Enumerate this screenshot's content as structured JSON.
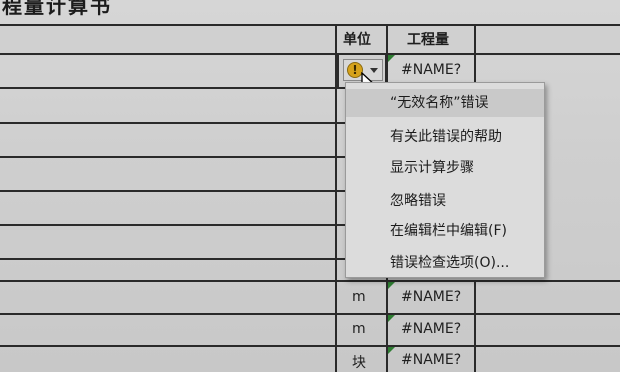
{
  "sheet": {
    "title": "程量计算书",
    "headers": {
      "unit": "单位",
      "quantity": "工程量"
    },
    "rows": [
      {
        "unit": "",
        "value": "#NAME?"
      },
      {
        "unit": "m",
        "value": "#NAME?"
      },
      {
        "unit": "m",
        "value": "#NAME?"
      },
      {
        "unit": "块",
        "value": "#NAME?"
      }
    ]
  },
  "error_button": {
    "icon": "warning-icon",
    "glyph": "!"
  },
  "context_menu": {
    "items": [
      {
        "label": "“无效名称”错误"
      },
      {
        "label": "有关此错误的帮助"
      },
      {
        "label": "显示计算步骤"
      },
      {
        "label": "忽略错误"
      },
      {
        "label": "在编辑栏中编辑(F)"
      },
      {
        "label": "错误检查选项(O)..."
      }
    ]
  },
  "colors": {
    "error_indicator": "#2e7d32",
    "warning": "#d6a21a"
  }
}
